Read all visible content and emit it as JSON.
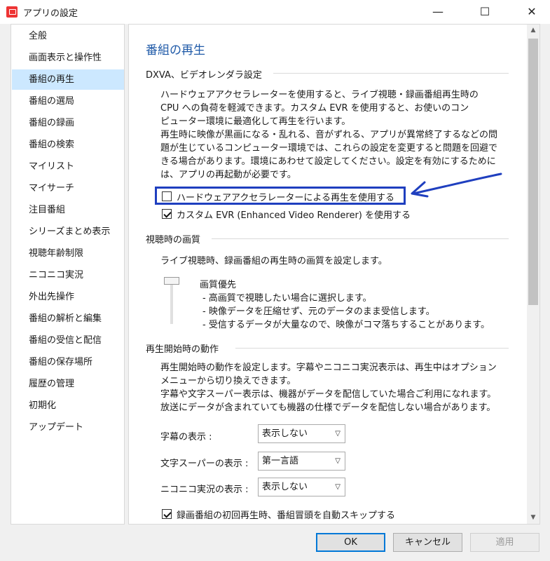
{
  "window": {
    "title": "アプリの設定",
    "minimize": "—",
    "maximize": "☐",
    "close": "✕"
  },
  "sidebar": {
    "items": [
      "全般",
      "画面表示と操作性",
      "番組の再生",
      "番組の選局",
      "番組の録画",
      "番組の検索",
      "マイリスト",
      "マイサーチ",
      "注目番組",
      "シリーズまとめ表示",
      "視聴年齢制限",
      "ニコニコ実況",
      "外出先操作",
      "番組の解析と編集",
      "番組の受信と配信",
      "番組の保存場所",
      "履歴の管理",
      "初期化",
      "アップデート"
    ],
    "selected_index": 2
  },
  "page": {
    "title": "番組の再生",
    "dxva": {
      "heading": "DXVA、ビデオレンダラ設定",
      "para1_lines": [
        "ハードウェアアクセラレーターを使用すると、ライブ視聴・録画番組再生時の",
        "CPU への負荷を軽減できます。カスタム EVR を使用すると、お使いのコン",
        "ピューター環境に最適化して再生を行います。"
      ],
      "para2_lines": [
        "再生時に映像が黒画になる・乱れる、音がずれる、アプリが異常終了するなどの問",
        "題が生じているコンピューター環境では、これらの設定を変更すると問題を回避で",
        "きる場合があります。環境にあわせて設定してください。設定を有効にするために",
        "は、アプリの再起動が必要です。"
      ],
      "hw_accel_label": "ハードウェアアクセラレーターによる再生を使用する",
      "hw_accel_checked": false,
      "custom_evr_label": "カスタム EVR (Enhanced Video Renderer) を使用する",
      "custom_evr_checked": true
    },
    "quality": {
      "heading": "視聴時の画質",
      "desc": "ライブ視聴時、録画番組の再生時の画質を設定します。",
      "slider_label": "画質優先",
      "bullets": [
        "-  高画質で視聴したい場合に選択します。",
        "-  映像データを圧縮せず、元のデータのまま受信します。",
        "-  受信するデータが大量なので、映像がコマ落ちすることがあります。"
      ]
    },
    "playback_start": {
      "heading": "再生開始時の動作",
      "desc_lines": [
        "再生開始時の動作を設定します。字幕やニコニコ実況表示は、再生中はオプション",
        "メニューから切り換えできます。",
        "字幕や文字スーパー表示は、機器がデータを配信していた場合ご利用になれます。",
        "放送にデータが含まれていても機器の仕様でデータを配信しない場合があります。"
      ],
      "subtitle_label": "字幕の表示 :",
      "subtitle_value": "表示しない",
      "super_label": "文字スーパーの表示 :",
      "super_value": "第一言語",
      "nico_label": "ニコニコ実況の表示 :",
      "nico_value": "表示しない",
      "skip_label": "録画番組の初回再生時、番組冒頭を自動スキップする",
      "skip_checked": true
    }
  },
  "buttons": {
    "ok": "OK",
    "cancel": "キャンセル",
    "apply": "適用"
  },
  "colors": {
    "accent_title": "#1f5aa8",
    "selection": "#cce8ff",
    "annotation": "#1f3fbf",
    "ok_border": "#0078d7"
  }
}
